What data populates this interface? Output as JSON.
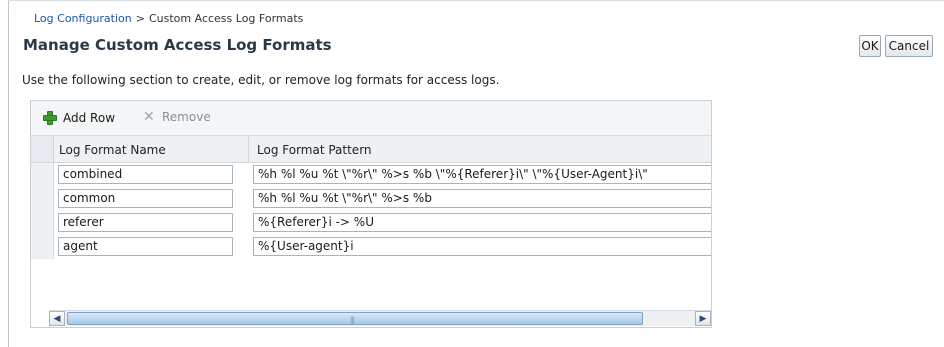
{
  "breadcrumb": {
    "parent": "Log Configuration",
    "separator": ">",
    "current": "Custom Access Log Formats"
  },
  "page": {
    "title": "Manage Custom Access Log Formats",
    "instructions": "Use the following section to create, edit, or remove log formats for access logs."
  },
  "actions": {
    "ok_label": "OK",
    "cancel_label": "Cancel"
  },
  "toolbar": {
    "add_label": "Add Row",
    "remove_label": "Remove",
    "add_icon": "add-plus-icon",
    "remove_icon": "remove-x-icon"
  },
  "table": {
    "columns": [
      "Log Format Name",
      "Log Format Pattern"
    ],
    "rows": [
      {
        "name": "combined",
        "pattern": "%h %l %u %t \\\"%r\\\" %>s %b \\\"%{Referer}i\\\" \\\"%{User-Agent}i\\\""
      },
      {
        "name": "common",
        "pattern": "%h %l %u %t \\\"%r\\\" %>s %b"
      },
      {
        "name": "referer",
        "pattern": "%{Referer}i -> %U"
      },
      {
        "name": "agent",
        "pattern": "%{User-agent}i"
      }
    ]
  },
  "colors": {
    "link": "#1c55a8",
    "title": "#2b3847",
    "add_icon": "#3c9a2e",
    "scroll_thumb": "#a9c7e6"
  }
}
